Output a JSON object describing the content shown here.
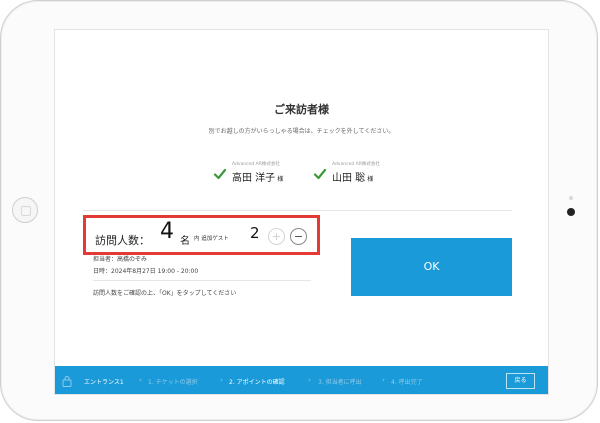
{
  "screen": {
    "title": "ご来訪者様",
    "subtitle": "別でお越しの方がいらっしゃる場合は、チェックを外してください。"
  },
  "guests": [
    {
      "company": "Advanced AR株式会社",
      "name": "高田 洋子",
      "honorific": "様",
      "checked": true
    },
    {
      "company": "Advanced AR株式会社",
      "name": "山田 聡",
      "honorific": "様",
      "checked": true
    }
  ],
  "visitor": {
    "label": "訪問人数：",
    "count": "4",
    "unit": "名",
    "inner_label": "内 追加ゲスト",
    "guest_count": "2",
    "plus_symbol": "+",
    "minus_symbol": "−"
  },
  "appointment": {
    "staff": "担当者：高橋のぞみ",
    "datetime": "日時：2024年8月27日 19:00 - 20:00"
  },
  "instruction": "訪問人数をご確認の上、「OK」をタップしてください",
  "ok_label": "OK",
  "breadcrumb": {
    "items": [
      {
        "label": "エントランス1",
        "active": true
      },
      {
        "label": "1. チケットの選択",
        "active": false
      },
      {
        "label": "2. アポイントの確認",
        "active": true
      },
      {
        "label": "3. 担当者に呼出",
        "active": false
      },
      {
        "label": "4. 呼出完了",
        "active": false
      }
    ],
    "back_label": "戻る"
  },
  "colors": {
    "accent": "#1a9ad8",
    "highlight": "#e53935",
    "check": "#3a9a3a"
  }
}
